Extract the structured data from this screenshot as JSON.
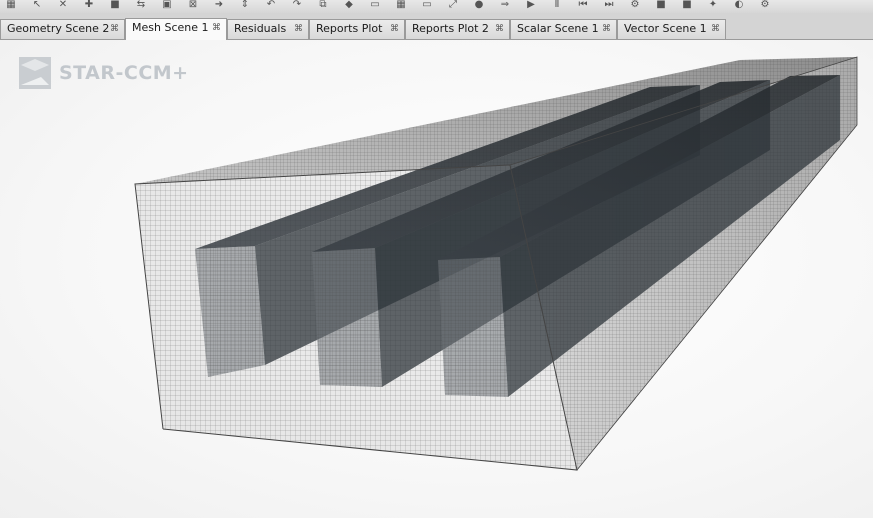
{
  "tabs": [
    {
      "label": "Geometry Scene 2",
      "active": false
    },
    {
      "label": "Mesh Scene 1",
      "active": true
    },
    {
      "label": "Residuals",
      "active": false
    },
    {
      "label": "Reports Plot",
      "active": false
    },
    {
      "label": "Reports Plot 2",
      "active": false
    },
    {
      "label": "Scalar Scene 1",
      "active": false
    },
    {
      "label": "Vector Scene 1",
      "active": false
    }
  ],
  "tab_close_glyph": "⌘",
  "logo": {
    "text": "STAR-CCM+",
    "color": "#c2c7cc"
  },
  "toolbar_icons": [
    "grid-icon",
    "arrow-icon",
    "x-axis-icon",
    "y-axis-icon",
    "stop-icon",
    "split-icon",
    "frame-icon",
    "image-icon",
    "arrow-right-icon",
    "move-icon",
    "rotate-left-icon",
    "rotate-right-icon",
    "copy-icon",
    "layer-icon",
    "window-icon",
    "table-icon",
    "window2-icon",
    "expand-icon",
    "record-icon",
    "export-icon",
    "play-icon",
    "pause-icon",
    "step-back-icon",
    "step-forward-icon",
    "settings-icon",
    "color-icon",
    "color2-icon",
    "star-icon",
    "palette-icon",
    "gear-icon"
  ],
  "colors": {
    "mesh_line": "#5a5a5a",
    "channel_dark": "#2f353b",
    "tab_active": "#fafafa",
    "tab_inactive": "#e3e3e3"
  }
}
